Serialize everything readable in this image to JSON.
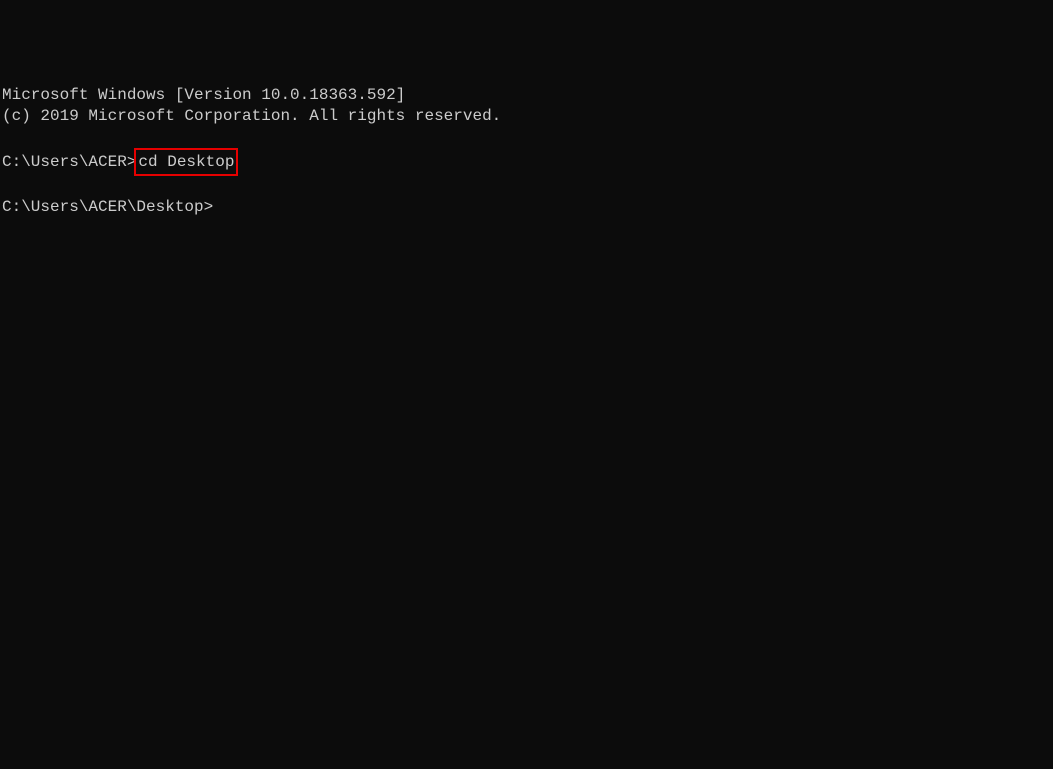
{
  "header": {
    "line1": "Microsoft Windows [Version 10.0.18363.592]",
    "line2": "(c) 2019 Microsoft Corporation. All rights reserved."
  },
  "prompt1": {
    "path": "C:\\Users\\ACER>",
    "command": "cd Desktop"
  },
  "prompt2": {
    "path": "C:\\Users\\ACER\\Desktop>"
  }
}
